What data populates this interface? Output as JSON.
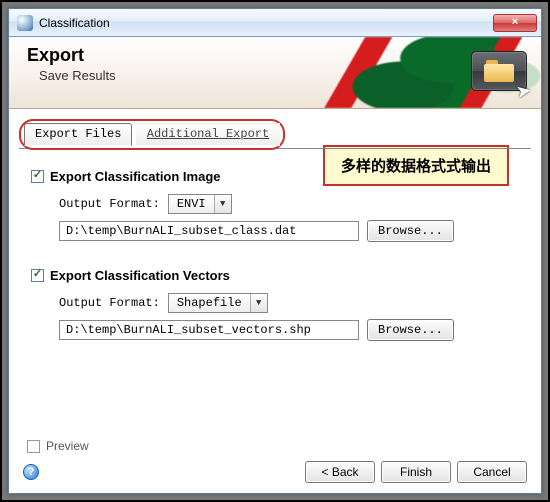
{
  "window": {
    "title": "Classification",
    "close_glyph": "×"
  },
  "banner": {
    "heading": "Export",
    "subtitle": "Save Results"
  },
  "tabs": {
    "export_files": "Export Files",
    "additional_export": "Additional Export"
  },
  "annotation": "多样的数据格式式输出",
  "sections": {
    "image": {
      "title": "Export Classification Image",
      "checked": true,
      "format_label": "Output Format:",
      "format_value": "ENVI",
      "path": "D:\\temp\\BurnALI_subset_class.dat",
      "browse": "Browse..."
    },
    "vectors": {
      "title": "Export Classification Vectors",
      "checked": true,
      "format_label": "Output Format:",
      "format_value": "Shapefile",
      "path": "D:\\temp\\BurnALI_subset_vectors.shp",
      "browse": "Browse..."
    }
  },
  "preview": {
    "label": "Preview",
    "checked": false
  },
  "buttons": {
    "back": "< Back",
    "finish": "Finish",
    "cancel": "Cancel"
  },
  "help_glyph": "?"
}
